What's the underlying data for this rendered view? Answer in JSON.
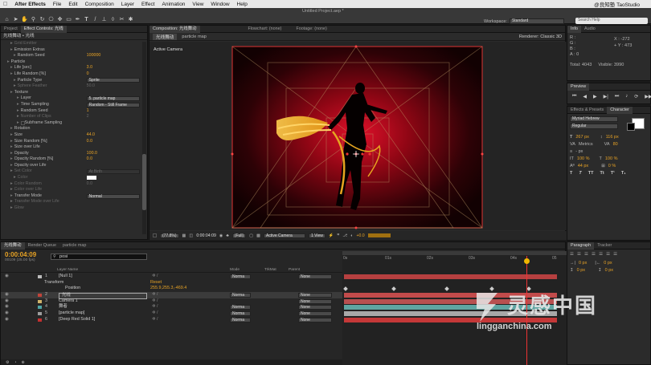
{
  "menubar": {
    "app": "After Effects",
    "items": [
      "File",
      "Edit",
      "Composition",
      "Layer",
      "Effect",
      "Animation",
      "View",
      "Window",
      "Help"
    ],
    "right": "@良知塾 TaoStudio"
  },
  "toolbar": {
    "title": "Untitled Project.aep *",
    "workspace_label": "Workspace:",
    "workspace": "Standard",
    "search_placeholder": "Search Help"
  },
  "project_panel": {
    "tab_project": "Project",
    "tab_effect_controls": "Effect Controls: 光线",
    "breadcrumb": "光线舞动 • 光线"
  },
  "effect_controls": [
    {
      "label": "Grid Emitter",
      "indent": 2,
      "dim": true
    },
    {
      "label": "Emission Extras",
      "indent": 2
    },
    {
      "label": "Random Seed",
      "indent": 3,
      "value": "100000"
    },
    {
      "label": "Particle",
      "indent": 1
    },
    {
      "label": "Life [sec]",
      "indent": 2,
      "value": "3.0"
    },
    {
      "label": "Life Random [%]",
      "indent": 2,
      "value": "0"
    },
    {
      "label": "Particle Type",
      "indent": 3,
      "dropdown": "Sprite"
    },
    {
      "label": "Sphere Feather",
      "indent": 3,
      "value": "50.0",
      "dim": true
    },
    {
      "label": "Texture",
      "indent": 2
    },
    {
      "label": "Layer",
      "indent": 4,
      "dropdown": "5. particle map"
    },
    {
      "label": "Time Sampling",
      "indent": 4,
      "dropdown": "Random - Still Frame"
    },
    {
      "label": "Random Seed",
      "indent": 4,
      "value": "1"
    },
    {
      "label": "Number of Clips",
      "indent": 4,
      "value": "2",
      "dim": true
    },
    {
      "label": "Subframe Sampling",
      "indent": 4,
      "check": true
    },
    {
      "label": "Rotation",
      "indent": 2
    },
    {
      "label": "Size",
      "indent": 2,
      "value": "44.0"
    },
    {
      "label": "Size Random [%]",
      "indent": 2,
      "value": "0.0"
    },
    {
      "label": "Size over Life",
      "indent": 2
    },
    {
      "label": "Opacity",
      "indent": 2,
      "value": "100.0"
    },
    {
      "label": "Opacity Random [%]",
      "indent": 2,
      "value": "0.0"
    },
    {
      "label": "Opacity over Life",
      "indent": 2
    },
    {
      "label": "Set Color",
      "indent": 2,
      "dropdown": "At Birth",
      "dim": true
    },
    {
      "label": "Color",
      "indent": 3,
      "dim": true,
      "swatch": true
    },
    {
      "label": "Color Random",
      "indent": 2,
      "value": "0.0",
      "dim": true
    },
    {
      "label": "Color over Life",
      "indent": 2,
      "dim": true
    },
    {
      "label": "Transfer Mode",
      "indent": 2,
      "dropdown": "Normal"
    },
    {
      "label": "Transfer Mode over Life",
      "indent": 2,
      "dim": true
    },
    {
      "label": "Glow",
      "indent": 2,
      "dim": true
    }
  ],
  "composition": {
    "tab": "Composition: 光线舞动",
    "tab_flowchart": "Flowchart: (none)",
    "tab_footage": "Footage: (none)",
    "crumb1": "光线舞动",
    "crumb2": "particle map",
    "renderer": "Renderer: Classic 3D",
    "camera_label": "Active Camera",
    "zoom": "(77.8%)",
    "time": "0:00:04:09",
    "res": "(Full)",
    "view": "Active Camera",
    "views": "1 View",
    "exposure": "+0.0"
  },
  "info": {
    "tab_info": "Info",
    "tab_audio": "Audio",
    "r": "R :",
    "g": "G :",
    "b": "B :",
    "a": "A : 0",
    "x": "X : -272",
    "y": "+ Y : 473",
    "total": "Total: 4043",
    "visible": "Visible: 3990"
  },
  "preview": {
    "tab": "Preview"
  },
  "character": {
    "tab_effects": "Effects & Presets",
    "tab_character": "Character",
    "font": "Myriad Hebrew",
    "style": "Regular",
    "size": "267 px",
    "leading": "116 px",
    "tracking_label": "Metrics",
    "tracking": "80",
    "stroke": "- px",
    "scale_v": "100 %",
    "scale_h": "100 %",
    "baseline": "44 px",
    "tsume": "0 %"
  },
  "paragraph": {
    "tab": "Paragraph",
    "tab_tracker": "Tracker",
    "indent_l": "0 px",
    "indent_r": "0 px",
    "space_b": "0 px",
    "space_a": "0 px"
  },
  "timeline": {
    "tab_comp": "光线舞动",
    "tab_render": "Render Queue",
    "tab_map": "particle map",
    "time": "0:00:04:09",
    "frames": "00109 (25.00 fps)",
    "search": "posi",
    "col_layer": "Layer Name",
    "col_mode": "Mode",
    "col_trk": "TrkMat",
    "col_parent": "Parent",
    "ruler": [
      "0s",
      "01s",
      "02s",
      "03s",
      "04s",
      "05"
    ],
    "layers": [
      {
        "num": "1",
        "name": "[Null 1]",
        "mode": "Norma",
        "parent": "None",
        "color": "#bcbcbc",
        "bar": "#b64040"
      },
      {
        "name": "Transform",
        "sub": true,
        "value": "Reset"
      },
      {
        "name": "Position",
        "sub2": true,
        "value": "255.9,255.3,-469.4"
      },
      {
        "num": "2",
        "name": "光线",
        "mode": "Norma",
        "parent": "None",
        "color": "#c1443a",
        "bar": "#c24b4b",
        "selected": true
      },
      {
        "num": "3",
        "name": "Camera 1",
        "mode": "",
        "parent": "None",
        "color": "#d0b36a",
        "bar": "#b85050"
      },
      {
        "num": "4",
        "name": "舞者",
        "mode": "Norma",
        "parent": "None",
        "color": "#4fa5a5",
        "bar": "#5fa5a2"
      },
      {
        "num": "5",
        "name": "[particle map]",
        "mode": "Norma",
        "parent": "None",
        "color": "#9e9e9e",
        "bar": "#a8a8a8"
      },
      {
        "num": "6",
        "name": "[Deep Red Solid 1]",
        "mode": "Norma",
        "parent": "None",
        "color": "#c43030",
        "bar": "#c43838"
      }
    ]
  },
  "watermark": {
    "cn": "灵感中国",
    "url": "lingganchina.com"
  }
}
